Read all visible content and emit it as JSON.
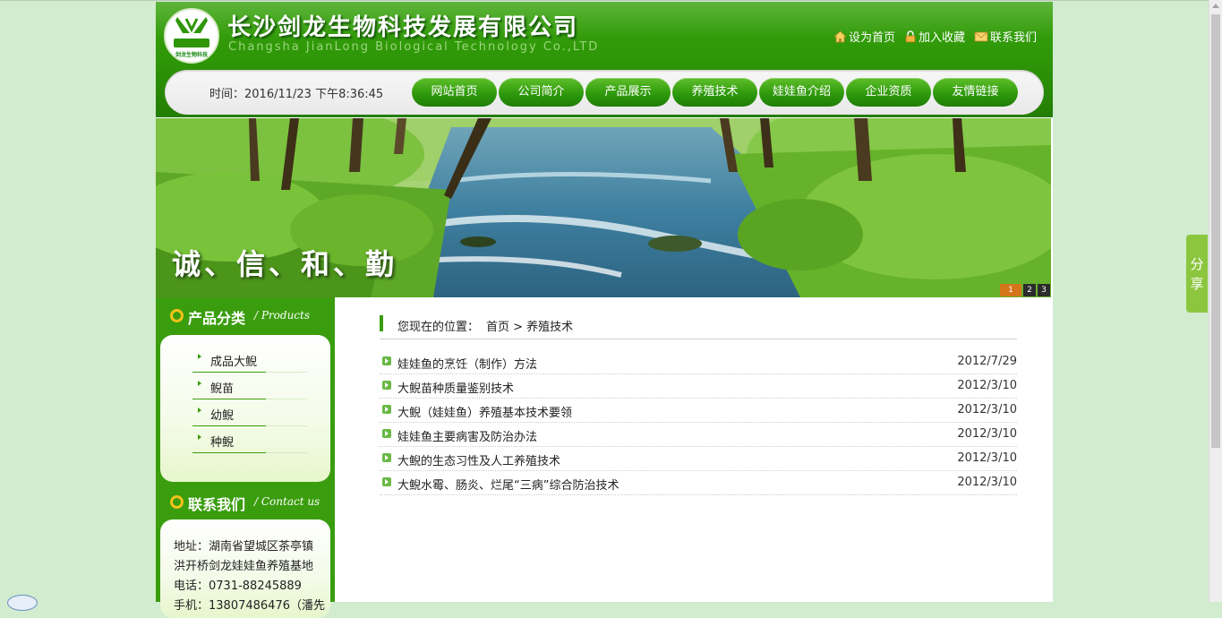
{
  "header": {
    "logo_text": "剑龙生物科技",
    "company_cn": "长沙剑龙生物科技发展有限公司",
    "company_en": "Changsha JianLong Biological Technology Co.,LTD",
    "links": [
      {
        "label": "设为首页",
        "icon": "home-icon"
      },
      {
        "label": "加入收藏",
        "icon": "lock-icon"
      },
      {
        "label": "联系我们",
        "icon": "mail-icon"
      }
    ]
  },
  "nav": {
    "time_label": "时间：",
    "time_value": "2016/11/23 下午8:36:45",
    "items": [
      "网站首页",
      "公司简介",
      "产品展示",
      "养殖技术",
      "娃娃鱼介绍",
      "企业资质",
      "友情链接"
    ]
  },
  "banner": {
    "slogan": "诚、信、和、勤",
    "dots": [
      "1",
      "2",
      "3"
    ],
    "active_dot": 0
  },
  "sidebar": {
    "products": {
      "title_cn": "产品分类",
      "title_en": "/ Products",
      "items": [
        "成品大鲵",
        "鲵苗",
        "幼鲵",
        "种鲵"
      ]
    },
    "contact": {
      "title_cn": "联系我们",
      "title_en": "/ Contact us",
      "lines": [
        "地址：湖南省望城区茶亭镇",
        "洪开桥剑龙娃娃鱼养殖基地",
        "电话：0731-88245889",
        "手机：13807486476（潘先"
      ]
    }
  },
  "main": {
    "breadcrumb": {
      "label": "您现在的位置：",
      "path": "首页 > 养殖技术"
    },
    "articles": [
      {
        "title": "娃娃鱼的烹饪（制作）方法",
        "date": "2012/7/29"
      },
      {
        "title": "大鲵苗种质量鉴别技术",
        "date": "2012/3/10"
      },
      {
        "title": "大鲵（娃娃鱼）养殖基本技术要领",
        "date": "2012/3/10"
      },
      {
        "title": "娃娃鱼主要病害及防治办法",
        "date": "2012/3/10"
      },
      {
        "title": "大鲵的生态习性及人工养殖技术",
        "date": "2012/3/10"
      },
      {
        "title": "大鲵水霉、肠炎、烂尾“三病”综合防治技术",
        "date": "2012/3/10"
      }
    ]
  },
  "share_tab": {
    "line1": "分",
    "line2": "享"
  },
  "colors": {
    "brand_green": "#2e9607",
    "accent_orange": "#d4751b",
    "page_bg": "#d2ecd0"
  }
}
